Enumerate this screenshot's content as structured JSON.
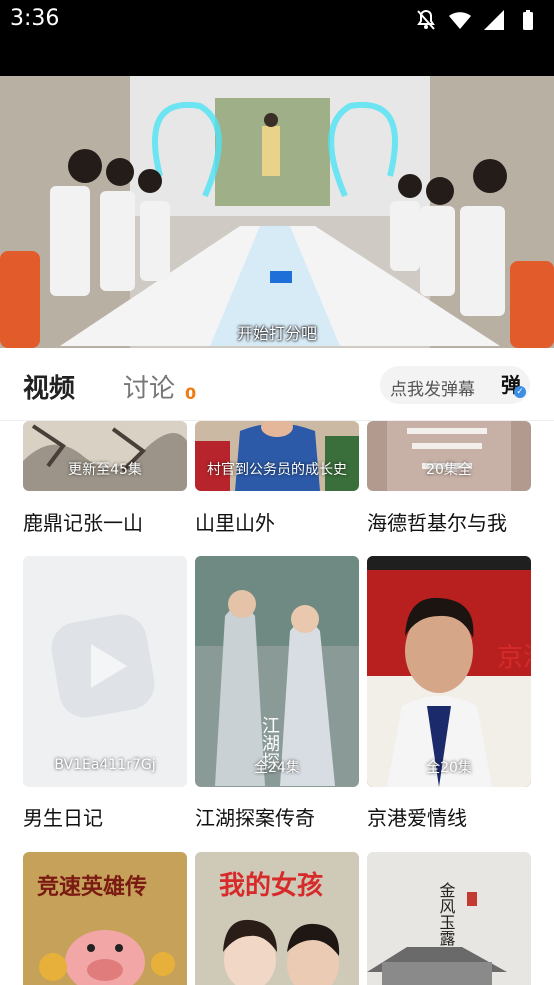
{
  "status_bar": {
    "time": "3:36"
  },
  "player": {
    "subtitle": "开始打分吧"
  },
  "tabs": {
    "video_label": "视频",
    "discuss_label": "讨论",
    "discuss_count": "0"
  },
  "danmu": {
    "label": "点我发弹幕",
    "button": "弹"
  },
  "series": [
    {
      "title": "鹿鼎记张一山",
      "badge": "更新至45集",
      "thumb_color": "#d9d2c4"
    },
    {
      "title": "山里山外",
      "badge": "村官到公务员的成长史",
      "thumb_color": "#2c5aa8"
    },
    {
      "title": "海德哲基尔与我",
      "badge": "20集全",
      "thumb_color": "#b39a8e"
    },
    {
      "title": "男生日记",
      "badge": "BV1Ea411r7Gj",
      "thumb_color": "#eef0f2"
    },
    {
      "title": "江湖探案传奇",
      "badge": "全24集",
      "thumb_color": "#8a9a96"
    },
    {
      "title": "京港爱情线",
      "badge": "全20集",
      "thumb_color": "#b82020"
    },
    {
      "title": "",
      "badge": "",
      "thumb_color": "#c5a15a"
    },
    {
      "title": "",
      "badge": "",
      "thumb_color": "#cfc9b8"
    },
    {
      "title": "",
      "badge": "",
      "thumb_color": "#e8e6e2"
    }
  ],
  "posters": {
    "hero_title": "竞速英雄传",
    "my_girl_title": "我的女孩",
    "jinggang_mark": "京港",
    "jianghu_mark": "江湖探",
    "poem": "金风玉露一相逢"
  }
}
